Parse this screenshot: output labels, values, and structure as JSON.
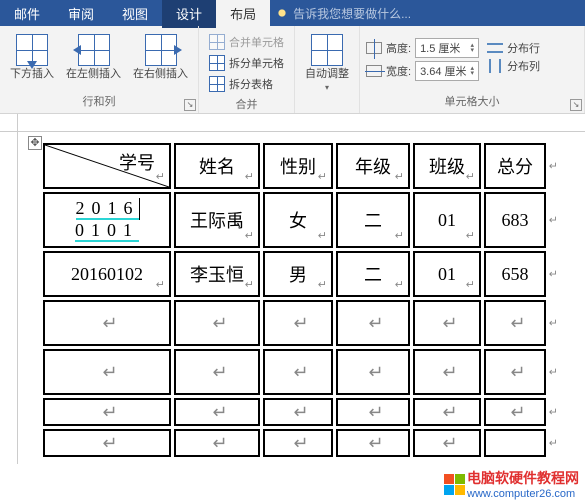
{
  "tabs": {
    "mail": "邮件",
    "review": "审阅",
    "view": "视图",
    "design": "设计",
    "layout": "布局"
  },
  "tellme": "告诉我您想要做什么...",
  "ribbon": {
    "rows_cols": {
      "insert_below": "下方插入",
      "insert_left": "在左侧插入",
      "insert_right": "在右侧插入",
      "group_label": "行和列"
    },
    "merge": {
      "merge_cells": "合并单元格",
      "split_cells": "拆分单元格",
      "split_table": "拆分表格",
      "group_label": "合并"
    },
    "autofit": {
      "label": "自动调整"
    },
    "cell_size": {
      "height_label": "高度:",
      "width_label": "宽度:",
      "height_value": "1.5 厘米",
      "width_value": "3.64 厘米",
      "group_label": "单元格大小"
    },
    "distribute": {
      "rows": "分布行",
      "cols": "分布列"
    }
  },
  "table": {
    "headers": [
      "学号",
      "姓名",
      "性别",
      "年级",
      "班级",
      "总分"
    ],
    "rows": [
      [
        "20160101",
        "王际禹",
        "女",
        "二",
        "01",
        "683"
      ],
      [
        "20160102",
        "李玉恒",
        "男",
        "二",
        "01",
        "658"
      ]
    ]
  },
  "watermark": {
    "text1": "电脑软硬件教程网",
    "text2": "www.computer26.com"
  }
}
